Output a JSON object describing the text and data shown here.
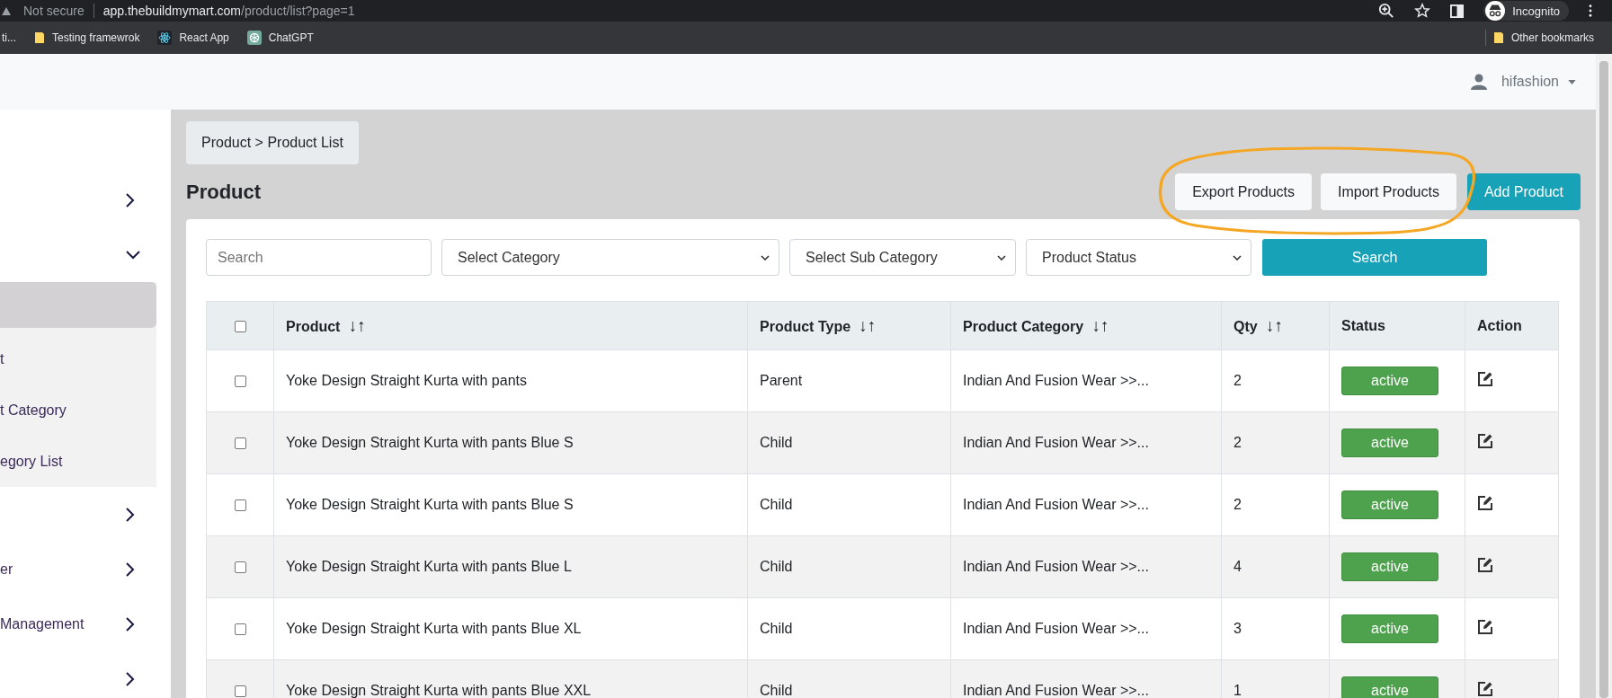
{
  "browser": {
    "security": "Not secure",
    "url_host": "app.thebuildmymart.com",
    "url_path": "/product/list?page=1",
    "profile": "Incognito",
    "bookmarks": [
      {
        "label": "ti...",
        "kind": "none"
      },
      {
        "label": "Testing framewrok",
        "kind": "folder"
      },
      {
        "label": "React App",
        "kind": "react"
      },
      {
        "label": "ChatGPT",
        "kind": "chatgpt"
      }
    ],
    "other_bookmarks": "Other bookmarks"
  },
  "header": {
    "user": "hifashion"
  },
  "sidebar": {
    "items": [
      {
        "expanded": false
      },
      {
        "expanded": true,
        "children": [
          {
            "selected": true
          },
          {
            "label": "t",
            "selected": false
          },
          {
            "label": "t Category",
            "selected": false
          },
          {
            "label": "egory List",
            "selected": false
          }
        ]
      },
      {
        "expanded": false
      },
      {
        "label": "er",
        "expanded": false
      },
      {
        "label": "Management",
        "expanded": false
      },
      {
        "expanded": false
      }
    ]
  },
  "breadcrumb": "Product > Product List",
  "page_title": "Product",
  "actions": [
    {
      "label": "Export Products",
      "kind": "secondary"
    },
    {
      "label": "Import Products",
      "kind": "secondary"
    },
    {
      "label": "Add Product",
      "kind": "primary"
    }
  ],
  "filters": {
    "search": {
      "placeholder": "Search"
    },
    "selects": [
      "Select Category",
      "Select Sub Category",
      "Product Status"
    ],
    "button": "Search"
  },
  "table": {
    "columns": [
      {
        "label": "Product",
        "sortable": true
      },
      {
        "label": "Product Type",
        "sortable": true
      },
      {
        "label": "Product Category",
        "sortable": true
      },
      {
        "label": "Qty",
        "sortable": true
      },
      {
        "label": "Status",
        "sortable": false
      },
      {
        "label": "Action",
        "sortable": false
      }
    ],
    "sort_glyph": "↓↑",
    "header_checked": false,
    "rows": [
      {
        "checked": false,
        "product": "Yoke Design Straight Kurta with pants",
        "type": "Parent",
        "category": "Indian And Fusion Wear >>...",
        "qty": "2",
        "status": "active"
      },
      {
        "checked": false,
        "product": "Yoke Design Straight Kurta with pants Blue S",
        "type": "Child",
        "category": "Indian And Fusion Wear >>...",
        "qty": "2",
        "status": "active"
      },
      {
        "checked": false,
        "product": "Yoke Design Straight Kurta with pants Blue S",
        "type": "Child",
        "category": "Indian And Fusion Wear >>...",
        "qty": "2",
        "status": "active"
      },
      {
        "checked": false,
        "product": "Yoke Design Straight Kurta with pants Blue L",
        "type": "Child",
        "category": "Indian And Fusion Wear >>...",
        "qty": "4",
        "status": "active"
      },
      {
        "checked": false,
        "product": "Yoke Design Straight Kurta with pants Blue XL",
        "type": "Child",
        "category": "Indian And Fusion Wear >>...",
        "qty": "3",
        "status": "active"
      },
      {
        "checked": false,
        "product": "Yoke Design Straight Kurta with pants Blue XXL",
        "type": "Child",
        "category": "Indian And Fusion Wear >>...",
        "qty": "1",
        "status": "active"
      }
    ]
  }
}
